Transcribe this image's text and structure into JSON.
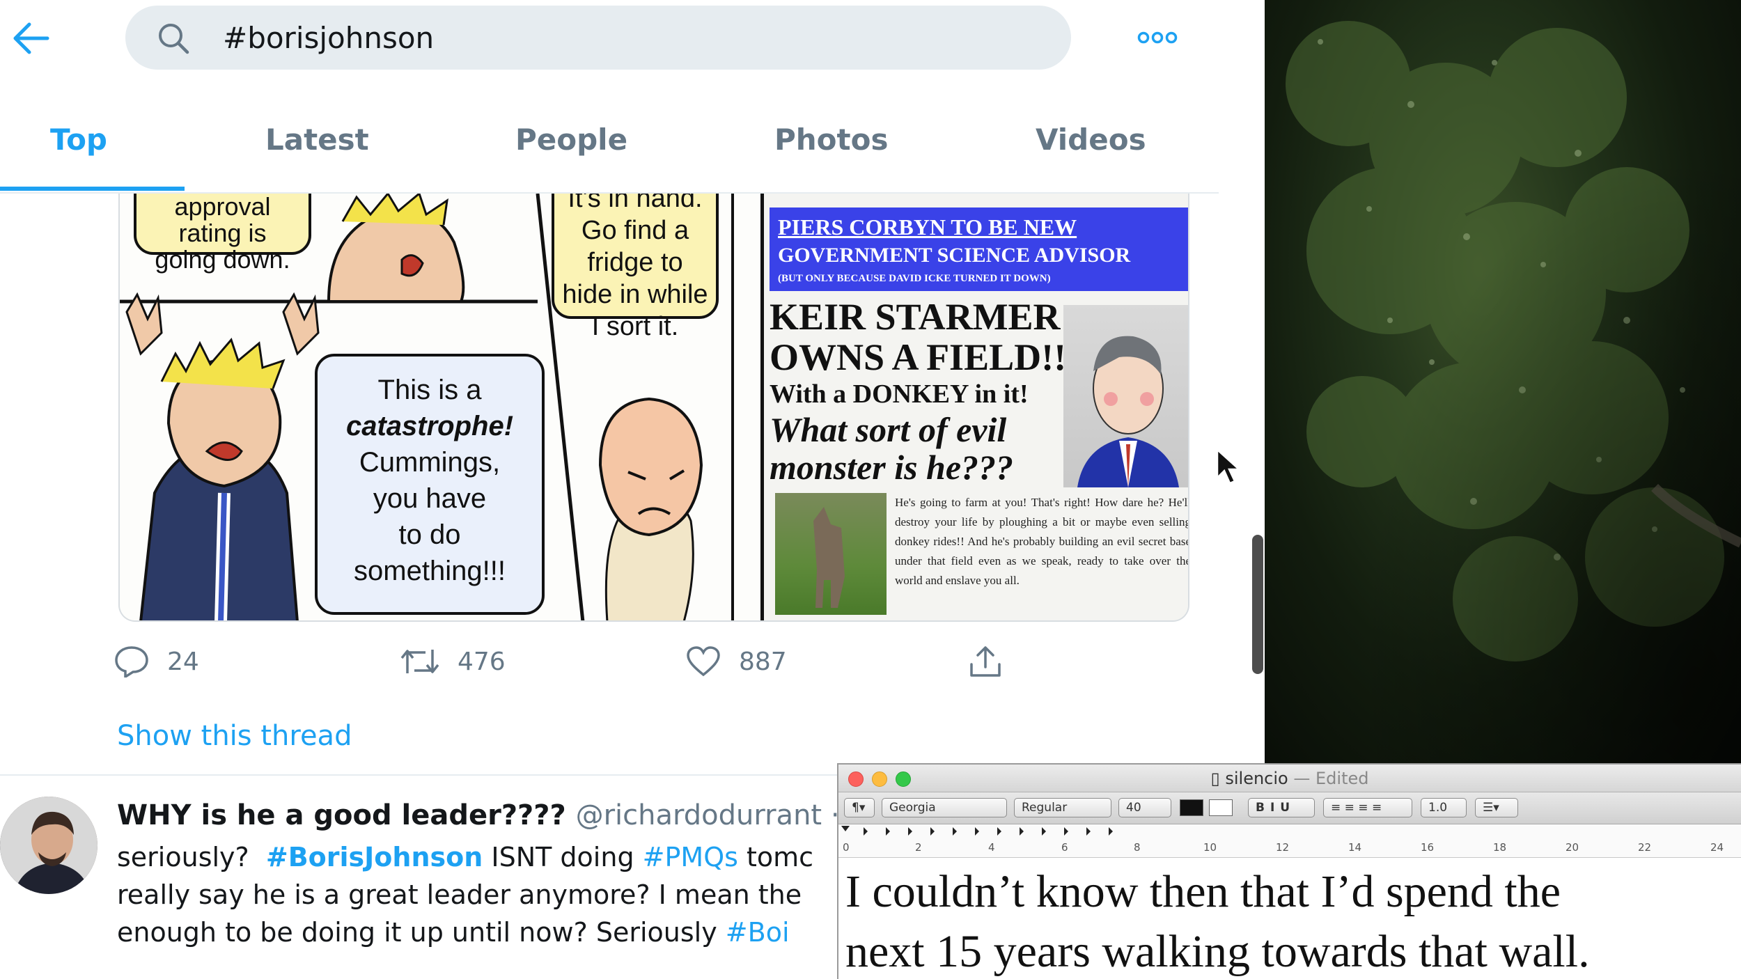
{
  "search": {
    "query": "#borisjohnson"
  },
  "tabs": [
    "Top",
    "Latest",
    "People",
    "Photos",
    "Videos"
  ],
  "comic": {
    "bubble_top_left": [
      "approval",
      "rating is",
      "going down."
    ],
    "bubble_top_mid": [
      "It's in hand.",
      "Go find a",
      "fridge to",
      "hide in while",
      "I sort it."
    ],
    "bubble_main": [
      "This is a",
      "catastrophe!",
      "Cummings,",
      "you have",
      "to do",
      "something!!!"
    ],
    "newspaper": {
      "banner_line1": "PIERS CORBYN TO BE NEW",
      "banner_line2": "GOVERNMENT SCIENCE ADVISOR",
      "banner_line3": "(BUT ONLY BECAUSE DAVID ICKE TURNED IT DOWN)",
      "headline1": "KEIR STARMER",
      "headline2": "OWNS A FIELD!!",
      "headline3": "With a DONKEY in it!",
      "headline4": "What sort of evil",
      "headline5": "monster is he???",
      "body": "He's going to farm at you! That's right! How dare he? He'll destroy your life by ploughing a bit or maybe even selling donkey rides!! And he's probably building an evil secret base under that field even as we speak, ready to take over the world and enslave you all."
    }
  },
  "tweet_actions": {
    "replies": "24",
    "retweets": "476",
    "likes": "887"
  },
  "show_thread": "Show this thread",
  "tweet2": {
    "name": "WHY is he a good leader????",
    "handle": "@richardodurrant ·",
    "line1_a": "seriously?",
    "line1_tag": "#BorisJohnson",
    "line1_b": "ISNT doing",
    "line1_tag2": "#PMQs",
    "line1_c": "tomc",
    "line2": "really say he is a great leader anymore?  I mean the",
    "line3_a": "enough to be doing it up until now?  Seriously",
    "line3_tag": "#Boi"
  },
  "textedit": {
    "title": "silencio",
    "edited": "— Edited",
    "font": "Georgia",
    "style": "Regular",
    "size": "40",
    "spacing": "1.0",
    "ruler_labels": [
      "0",
      "2",
      "4",
      "6",
      "8",
      "10",
      "12",
      "14",
      "16",
      "18",
      "20",
      "22",
      "24"
    ],
    "text_line1": "I couldn’t know then that I’d spend the",
    "text_line2": "next 15 years walking towards that wall."
  },
  "colors": {
    "twitter_blue": "#1da1f2",
    "grey_text": "#657786",
    "newspaper_blue": "#3a42e8"
  }
}
